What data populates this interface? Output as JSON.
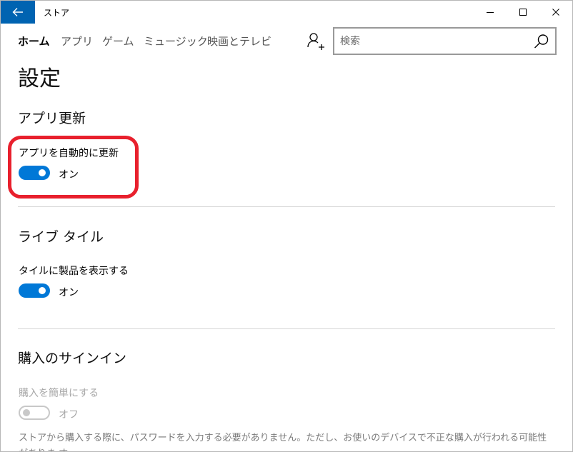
{
  "window": {
    "title": "ストア"
  },
  "nav": {
    "items": [
      {
        "label": "ホーム",
        "active": true
      },
      {
        "label": "アプリ",
        "active": false
      },
      {
        "label": "ゲーム",
        "active": false
      },
      {
        "label": "ミュージック",
        "active": false
      },
      {
        "label": "映画とテレビ",
        "active": false
      }
    ],
    "search": {
      "placeholder": "検索",
      "value": ""
    }
  },
  "page": {
    "title": "設定"
  },
  "sections": [
    {
      "heading": "アプリ更新",
      "setting": {
        "label": "アプリを自動的に更新",
        "state": "オン",
        "enabled": true,
        "on": true
      }
    },
    {
      "heading": "ライブ タイル",
      "setting": {
        "label": "タイルに製品を表示する",
        "state": "オン",
        "enabled": true,
        "on": true
      }
    },
    {
      "heading": "購入のサインイン",
      "setting": {
        "label": "購入を簡単にする",
        "state": "オフ",
        "enabled": false,
        "on": false
      },
      "note": "ストアから購入する際に、パスワードを入力する必要がありません。ただし、お使いのデバイスで不正な購入が行われる可能性がありま す。"
    }
  ],
  "colors": {
    "accent": "#0078d7",
    "back_button": "#0063b1",
    "highlight": "#e8202d"
  },
  "icons": [
    "back-arrow-icon",
    "minimize-icon",
    "maximize-icon",
    "close-icon",
    "account-add-icon",
    "search-icon"
  ]
}
